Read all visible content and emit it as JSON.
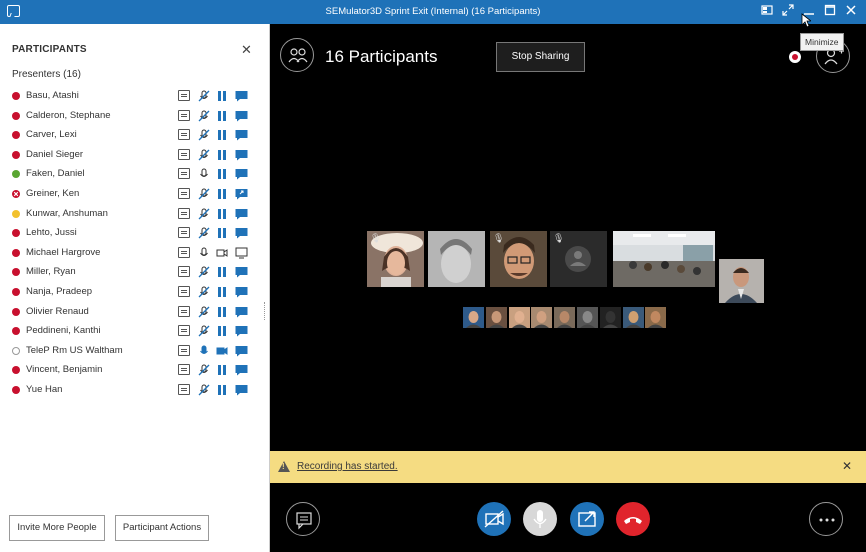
{
  "window": {
    "title": "SEMulator3D Sprint Exit (Internal) (16 Participants)",
    "tooltip": "Minimize"
  },
  "sidebar": {
    "header": "PARTICIPANTS",
    "close_glyph": "✕",
    "group_label": "Presenters (16)",
    "participants": [
      {
        "name": "Basu, Atashi",
        "status": "red",
        "mic": "muted",
        "video": "pause",
        "share": "on"
      },
      {
        "name": "Calderon, Stephane",
        "status": "red",
        "mic": "muted",
        "video": "pause",
        "share": "on"
      },
      {
        "name": "Carver, Lexi",
        "status": "red",
        "mic": "muted",
        "video": "pause",
        "share": "on"
      },
      {
        "name": "Daniel Sieger",
        "status": "red",
        "mic": "muted",
        "video": "pause",
        "share": "on"
      },
      {
        "name": "Faken, Daniel",
        "status": "green",
        "mic": "outline",
        "video": "pause",
        "share": "on"
      },
      {
        "name": "Greiner, Ken",
        "status": "red-x",
        "mic": "muted",
        "video": "pause",
        "share": "on-arrow"
      },
      {
        "name": "Kunwar, Anshuman",
        "status": "yellow",
        "mic": "muted",
        "video": "pause",
        "share": "on"
      },
      {
        "name": "Lehto, Jussi",
        "status": "red",
        "mic": "muted",
        "video": "pause",
        "share": "on"
      },
      {
        "name": "Michael Hargrove",
        "status": "red",
        "mic": "outline",
        "video": "camera-outline",
        "share": "outline"
      },
      {
        "name": "Miller, Ryan",
        "status": "red",
        "mic": "muted",
        "video": "pause",
        "share": "on"
      },
      {
        "name": "Nanja, Pradeep",
        "status": "red",
        "mic": "muted",
        "video": "pause",
        "share": "on"
      },
      {
        "name": "Olivier Renaud",
        "status": "red",
        "mic": "muted",
        "video": "pause",
        "share": "on"
      },
      {
        "name": "Peddineni, Kanthi",
        "status": "red",
        "mic": "muted",
        "video": "pause",
        "share": "on"
      },
      {
        "name": "TeleP Rm US Waltham",
        "status": "grey",
        "mic": "active",
        "video": "camera-active",
        "share": "on"
      },
      {
        "name": "Vincent, Benjamin",
        "status": "red",
        "mic": "muted",
        "video": "pause",
        "share": "on"
      },
      {
        "name": "Yue Han",
        "status": "red",
        "mic": "muted",
        "video": "pause",
        "share": "on"
      }
    ],
    "invite_label": "Invite More People",
    "actions_label": "Participant Actions"
  },
  "stage": {
    "participants_title": "16 Participants",
    "stop_sharing_label": "Stop Sharing",
    "banner_text": "Recording has started.",
    "banner_close": "✕"
  },
  "colors": {
    "titlebar": "#1f72b8",
    "status_red": "#c8102e",
    "status_green": "#5aa632",
    "status_yellow": "#f2c12e",
    "icon_blue": "#1f72b8",
    "banner": "#f5dc82",
    "video_btn": "#1f72b8",
    "share_btn": "#1f72b8",
    "hangup_btn": "#e0242c"
  }
}
